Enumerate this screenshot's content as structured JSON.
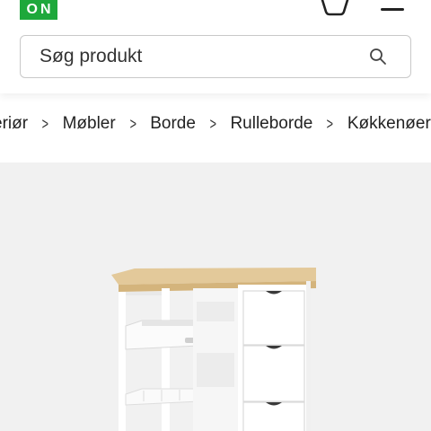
{
  "header": {
    "logo_text": "ON",
    "search": {
      "placeholder": "Søg produkt"
    }
  },
  "breadcrumb": {
    "items": [
      "Interiør",
      "Møbler",
      "Borde",
      "Rulleborde",
      "Køkkenøer"
    ],
    "visible_first_fragment": "eriør"
  },
  "product": {
    "image_icon": "kitchen-cart-image"
  },
  "colors": {
    "brand_green": "#1ea83b",
    "image_background": "#f1f1f1"
  }
}
